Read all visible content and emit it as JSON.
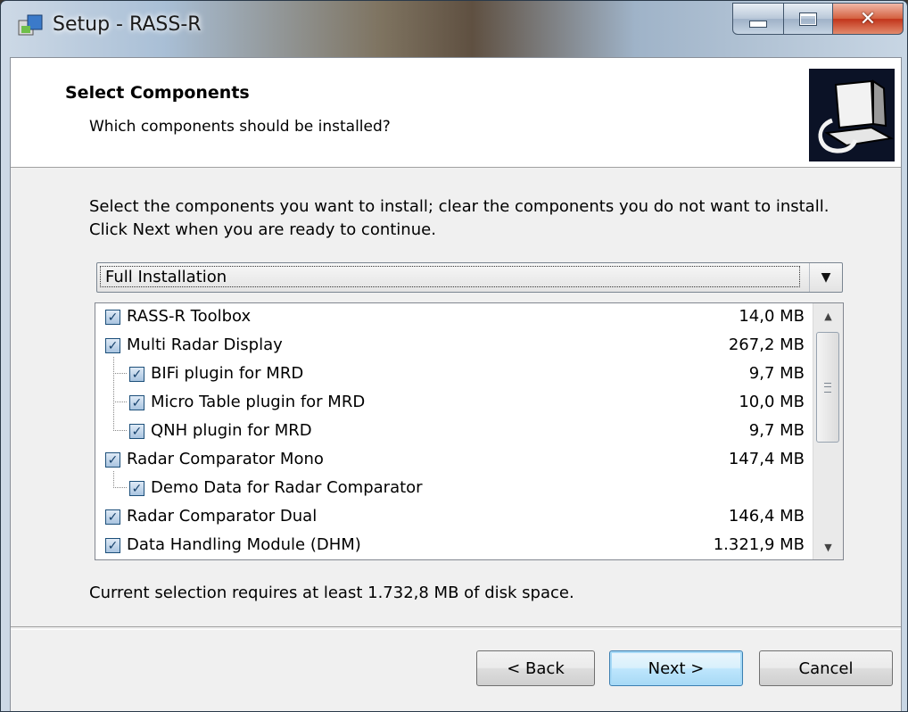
{
  "window": {
    "title": "Setup - RASS-R"
  },
  "header": {
    "title": "Select Components",
    "subtitle": "Which components should be installed?"
  },
  "instructions": "Select the components you want to install; clear the components you do not want to install. Click Next when you are ready to continue.",
  "install_type": {
    "selected": "Full Installation"
  },
  "components": [
    {
      "label": "RASS-R Toolbox",
      "size": "14,0 MB",
      "checked": true
    },
    {
      "label": "Multi Radar Display",
      "size": "267,2 MB",
      "checked": true
    },
    {
      "label": "BIFi plugin for MRD",
      "size": "9,7 MB",
      "checked": true
    },
    {
      "label": "Micro Table plugin for MRD",
      "size": "10,0 MB",
      "checked": true
    },
    {
      "label": "QNH plugin for MRD",
      "size": "9,7 MB",
      "checked": true
    },
    {
      "label": "Radar Comparator Mono",
      "size": "147,4 MB",
      "checked": true
    },
    {
      "label": "Demo Data for Radar Comparator",
      "size": "",
      "checked": true
    },
    {
      "label": "Radar Comparator Dual",
      "size": "146,4 MB",
      "checked": true
    },
    {
      "label": "Data Handling Module (DHM)",
      "size": "1.321,9 MB",
      "checked": true
    }
  ],
  "disk_note": "Current selection requires at least 1.732,8 MB of disk space.",
  "buttons": {
    "back": "< Back",
    "next": "Next >",
    "cancel": "Cancel"
  },
  "colors": {
    "next_button_accent": "#3c7fb1",
    "close_button": "#c2341a"
  },
  "icons": {
    "app": "setup-icon",
    "header": "computer-install-icon",
    "scroll_up": "arrow-up-icon",
    "scroll_down": "arrow-down-icon",
    "dropdown": "chevron-down-icon"
  }
}
